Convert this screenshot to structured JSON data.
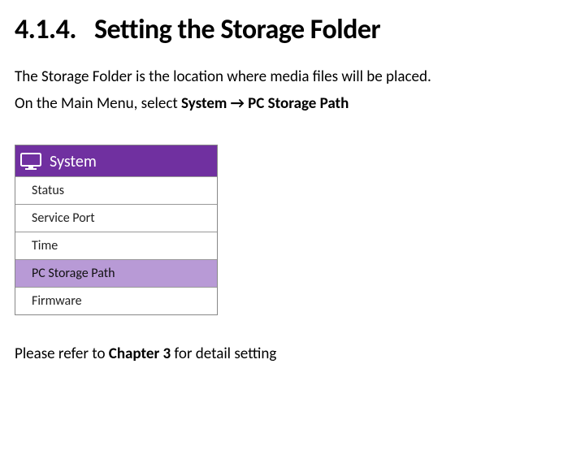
{
  "heading": {
    "number": "4.1.4.",
    "title": "Setting the Storage Folder"
  },
  "intro": {
    "line1": "The Storage Folder is the location where media files will be placed.",
    "line2_pre": "On the Main Menu, select ",
    "line2_menu1": "System",
    "line2_arrow": " → ",
    "line2_menu2": "PC Storage Path"
  },
  "menu": {
    "header": "System",
    "items": [
      "Status",
      "Service Port",
      "Time",
      "PC Storage Path",
      "Firmware"
    ]
  },
  "footer": {
    "pre": "Please refer to ",
    "chapter": "Chapter 3",
    "post": " for detail setting"
  }
}
